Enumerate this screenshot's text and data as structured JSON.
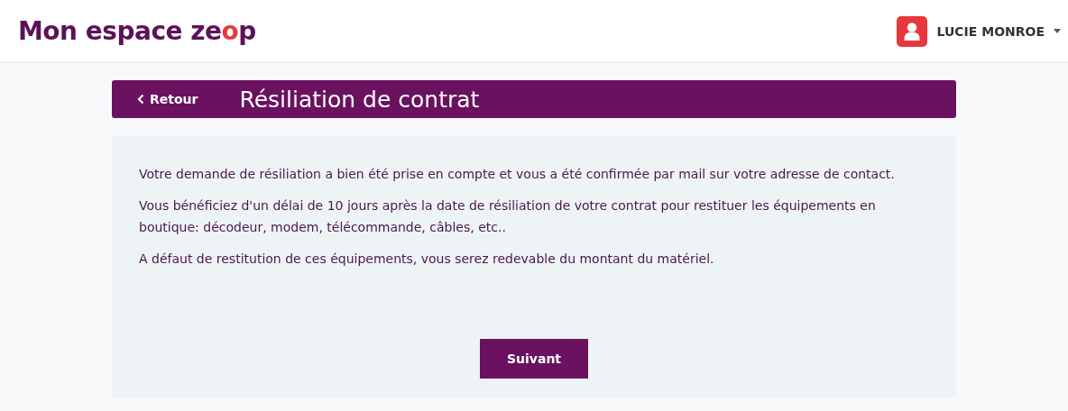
{
  "header": {
    "logo": [
      {
        "text": "Mon espace ze",
        "accent": false
      },
      {
        "text": "o",
        "accent": true
      },
      {
        "text": "p",
        "accent": false
      }
    ],
    "user": {
      "name": "LUCIE MONROE"
    }
  },
  "title_bar": {
    "back": "Retour",
    "title": "Résiliation de contrat"
  },
  "paragraphs": [
    "Votre demande de résiliation a bien été prise en compte et vous a été confirmée par mail sur votre adresse de contact.",
    "Vous bénéficiez d'un délai de 10 jours après la date de résiliation de votre contrat pour restituer les équipements en boutique: décodeur, modem, télécommande, câbles, etc..",
    "A défaut de restitution de ces équipements, vous serez redevable du montant du matériel."
  ],
  "buttons": [
    "Suivant"
  ]
}
